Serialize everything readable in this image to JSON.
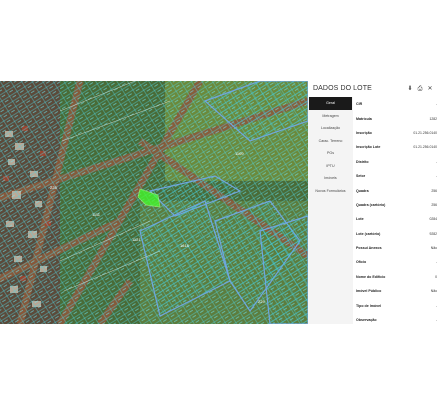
{
  "panel": {
    "title": "DADOS DO LOTE",
    "actions": [
      {
        "name": "download-icon",
        "glyph": "⬇"
      },
      {
        "name": "print-icon",
        "glyph": "⎙"
      },
      {
        "name": "close-icon",
        "glyph": "✕"
      }
    ],
    "tabs": [
      "Geral",
      "Metragem",
      "Localização",
      "Carac. Terreno",
      "PGs",
      "IPTU",
      "Imóveis",
      "Novos Formulários"
    ],
    "active_tab": 0,
    "fields": [
      {
        "label": "CIR",
        "value": "-"
      },
      {
        "label": "Matrícula",
        "value": "1282"
      },
      {
        "label": "Inscrição",
        "value": "01.21.256.0140"
      },
      {
        "label": "Inscrição Lote",
        "value": "01.21.256.0140"
      },
      {
        "label": "Distrito",
        "value": "-"
      },
      {
        "label": "Setor",
        "value": "-"
      },
      {
        "label": "Quadra",
        "value": "256"
      },
      {
        "label": "Quadra (cartório)",
        "value": "256"
      },
      {
        "label": "Lote",
        "value": "0284"
      },
      {
        "label": "Lote (cartório)",
        "value": "9282"
      },
      {
        "label": "Possui Anexos",
        "value": "Não"
      },
      {
        "label": "Ofício",
        "value": "-"
      },
      {
        "label": "Nome do Edifício",
        "value": "0"
      },
      {
        "label": "Imóvel Público",
        "value": "Não"
      },
      {
        "label": "Tipo de Imóvel",
        "value": "-"
      },
      {
        "label": "Observação",
        "value": "-"
      }
    ]
  },
  "map": {
    "labels": [
      "225",
      "1111",
      "1121",
      "1618",
      "1109",
      "229"
    ]
  }
}
